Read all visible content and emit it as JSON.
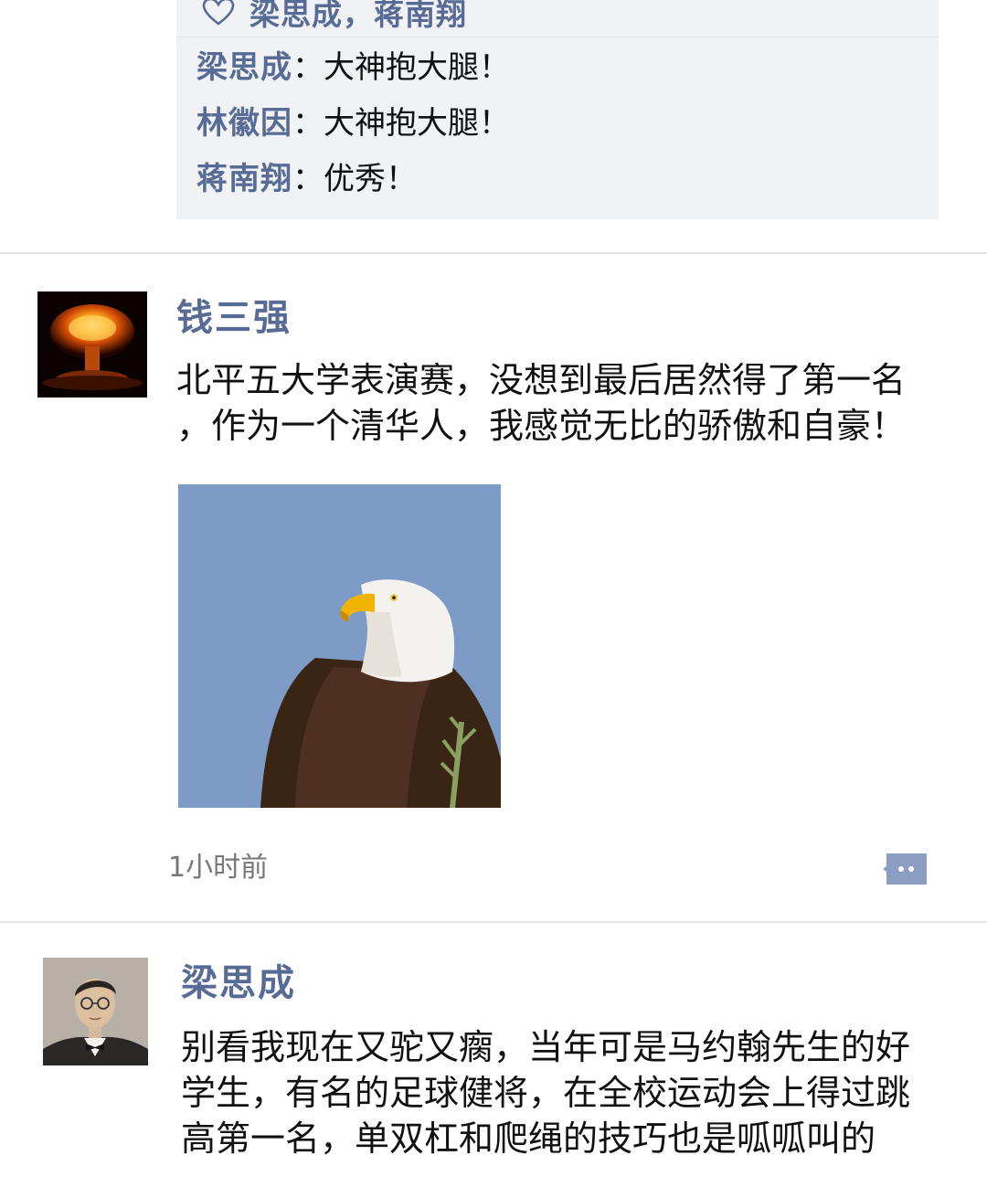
{
  "prev_post": {
    "likes": "梁思成，蒋南翔",
    "comments": [
      {
        "name": "梁思成",
        "sep": "：",
        "text": "大神抱大腿！"
      },
      {
        "name": "林徽因",
        "sep": "：",
        "text": "大神抱大腿！"
      },
      {
        "name": "蒋南翔",
        "sep": "：",
        "text": "优秀！"
      }
    ]
  },
  "posts": [
    {
      "author": "钱三强",
      "avatar_icon": "explosion-avatar",
      "text_lines": [
        "北平五大学表演赛，没想到最后居然得了第一名",
        "，作为一个清华人，我感觉无比的骄傲和自豪！"
      ],
      "image_icon": "eagle-photo",
      "time": "1小时前"
    },
    {
      "author": "梁思成",
      "avatar_icon": "portrait-avatar",
      "text_lines": [
        "别看我现在又驼又瘸，当年可是马约翰先生的好",
        "学生，有名的足球健将，在全校运动会上得过跳",
        "高第一名，单双杠和爬绳的技巧也是呱呱叫的"
      ]
    }
  ],
  "colors": {
    "name_blue": "#576b95",
    "comment_bg": "#f0f2f6",
    "sky_blue": "#7e9bc8"
  }
}
